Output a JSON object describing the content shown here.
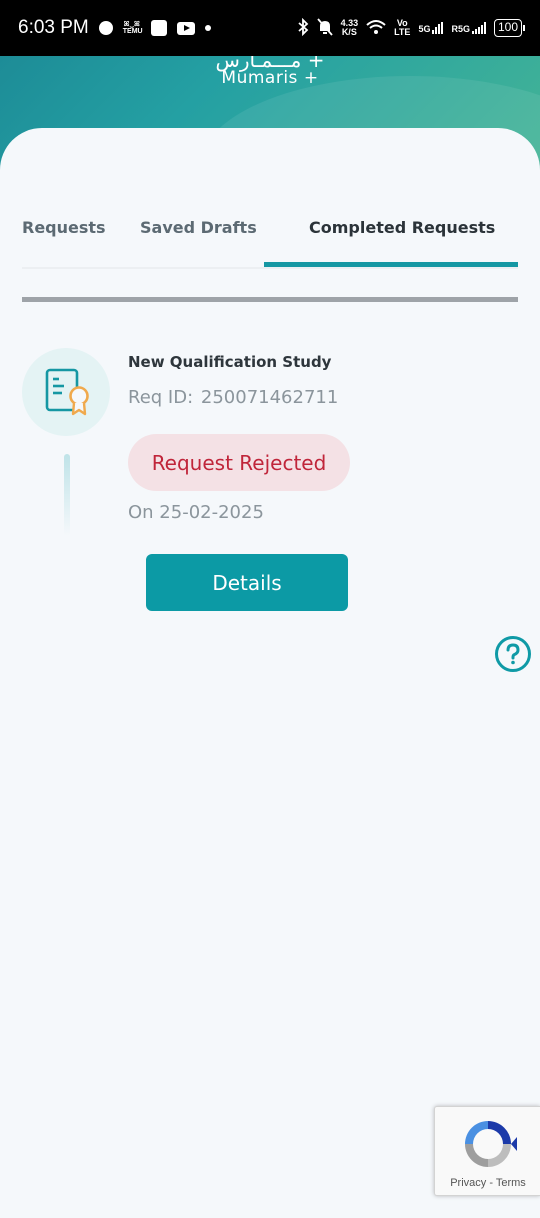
{
  "status_bar": {
    "time": "6:03 PM",
    "temu_top": "ꕤ‿ꕤ",
    "temu_bottom": "TEMU",
    "speed_value": "4.33",
    "speed_unit": "K/S",
    "volte_top": "Vo",
    "volte_bottom": "LTE",
    "net1": "5G",
    "net2": "R5G",
    "battery": "100",
    "icons": [
      "chat-bubble-icon",
      "temu-icon",
      "square-app-icon",
      "youtube-icon",
      "dot-icon",
      "bluetooth-icon",
      "mute-bell-icon",
      "wifi-icon",
      "signal-icon",
      "battery-icon"
    ]
  },
  "header": {
    "brand_arabic": "مـــمـارس +",
    "brand_english": "Mumaris +"
  },
  "tabs": [
    {
      "label": "Requests",
      "active": false
    },
    {
      "label": "Saved Drafts",
      "active": false
    },
    {
      "label": "Completed Requests",
      "active": true
    }
  ],
  "request": {
    "title": "New Qualification Study",
    "id_label": "Req ID:",
    "id_value": "250071462711",
    "status": "Request Rejected",
    "date": "On 25-02-2025",
    "details_label": "Details",
    "icon": "certificate-icon"
  },
  "help": {
    "icon": "help-question-icon"
  },
  "recaptcha": {
    "links": "Privacy - Terms"
  },
  "colors": {
    "accent": "#0c9aa5",
    "rejected_text": "#c0253a",
    "rejected_bg": "#f4e1e5",
    "icon_orange": "#f0a94c"
  }
}
